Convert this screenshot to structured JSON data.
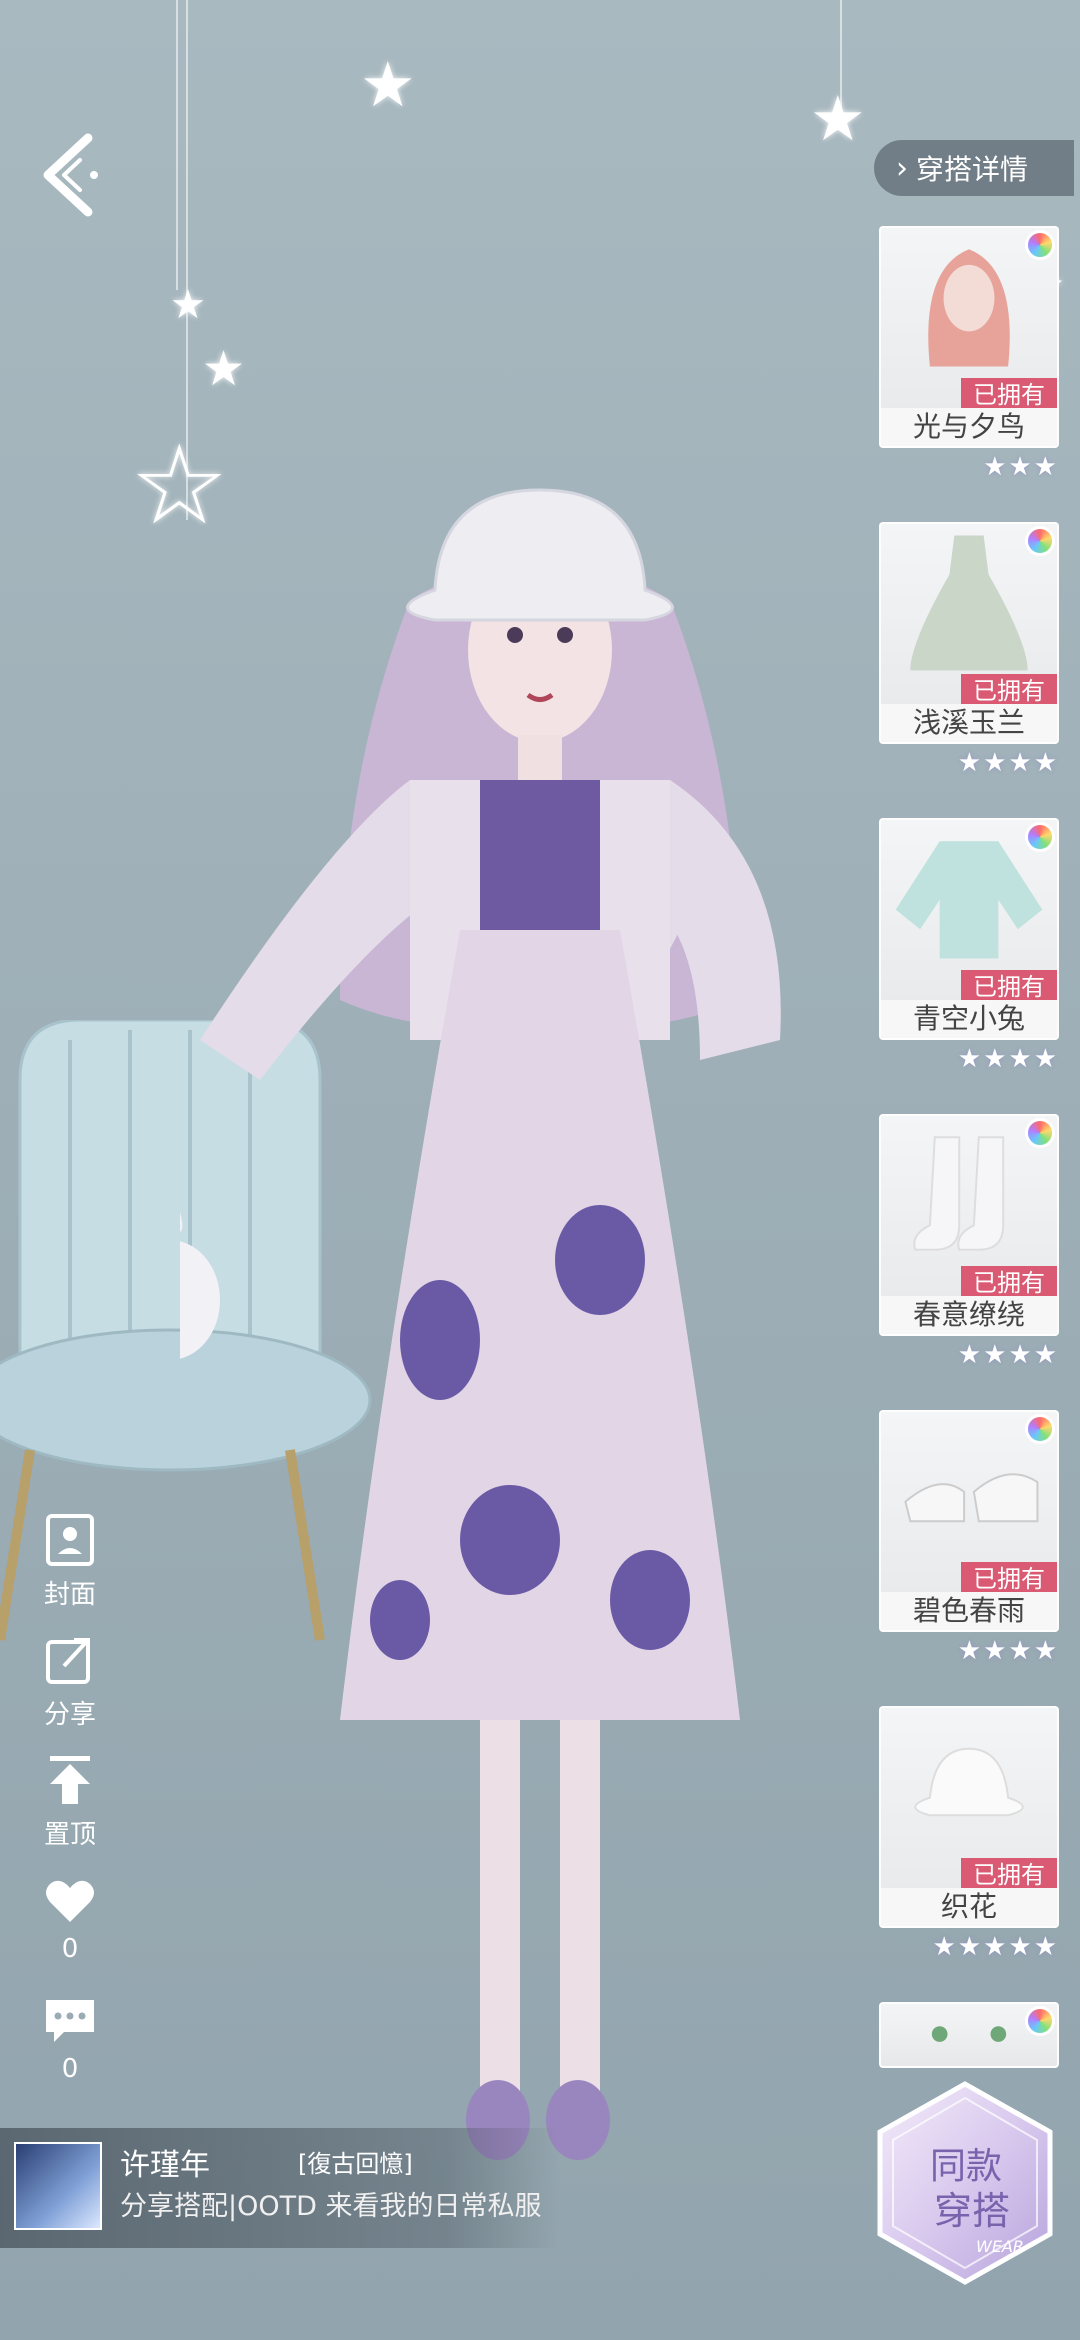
{
  "header": {
    "back_icon": "back-arrow-icon",
    "detail_label": "穿搭详情"
  },
  "items": [
    {
      "name": "光与夕鸟",
      "owned": "已拥有",
      "rating": "★★★",
      "stars": 3,
      "kind": "hair"
    },
    {
      "name": "浅溪玉兰",
      "owned": "已拥有",
      "rating": "★★★★",
      "stars": 4,
      "kind": "dress"
    },
    {
      "name": "青空小兔",
      "owned": "已拥有",
      "rating": "★★★★",
      "stars": 4,
      "kind": "coat"
    },
    {
      "name": "春意缭绕",
      "owned": "已拥有",
      "rating": "★★★★",
      "stars": 4,
      "kind": "socks"
    },
    {
      "name": "碧色春雨",
      "owned": "已拥有",
      "rating": "★★★★",
      "stars": 4,
      "kind": "shoes"
    },
    {
      "name": "织花",
      "owned": "已拥有",
      "rating": "★★★★★",
      "stars": 5,
      "kind": "hat"
    },
    {
      "name": "",
      "owned": "",
      "rating": "",
      "stars": 0,
      "kind": "earrings"
    }
  ],
  "tools": {
    "cover": "封面",
    "share": "分享",
    "pin": "置顶",
    "like_count": "0",
    "comment_count": "0"
  },
  "post": {
    "username": "许瑾年",
    "tag": "[復古回憶]",
    "text": "分享搭配|OOTD 来看我的日常私服"
  },
  "same_outfit": {
    "line1": "同款",
    "line2": "穿搭",
    "sub": "WEAR"
  },
  "colors": {
    "owned_badge": "#d95a72",
    "background": "#a3b3ba"
  }
}
